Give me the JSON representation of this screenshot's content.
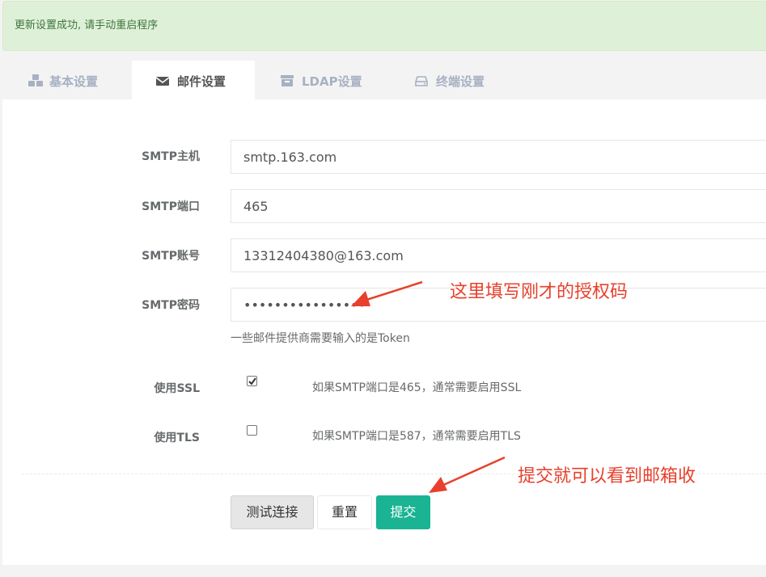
{
  "alert": {
    "message": "更新设置成功, 请手动重启程序"
  },
  "tabs": [
    {
      "label": "基本设置",
      "icon": "cubes-icon",
      "active": false
    },
    {
      "label": "邮件设置",
      "icon": "envelope-icon",
      "active": true
    },
    {
      "label": "LDAP设置",
      "icon": "archive-icon",
      "active": false
    },
    {
      "label": "终端设置",
      "icon": "hdd-icon",
      "active": false
    }
  ],
  "form": {
    "host": {
      "label": "SMTP主机",
      "value": "smtp.163.com"
    },
    "port": {
      "label": "SMTP端口",
      "value": "465"
    },
    "user": {
      "label": "SMTP账号",
      "value": "13312404380@163.com"
    },
    "password": {
      "label": "SMTP密码",
      "value": "••••••••••••••••",
      "help": "一些邮件提供商需要输入的是Token"
    },
    "ssl": {
      "label": "使用SSL",
      "checked": true,
      "hint": "如果SMTP端口是465，通常需要启用SSL"
    },
    "tls": {
      "label": "使用TLS",
      "checked": false,
      "hint": "如果SMTP端口是587，通常需要启用TLS"
    }
  },
  "buttons": {
    "test": "测试连接",
    "reset": "重置",
    "submit": "提交"
  },
  "annotations": {
    "password_note": "这里填写刚才的授权码",
    "submit_note": "提交就可以看到邮箱收"
  },
  "colors": {
    "success_bg": "#dff0d8",
    "success_text": "#3c763d",
    "primary": "#1ab394",
    "annotation": "#e8402c"
  }
}
